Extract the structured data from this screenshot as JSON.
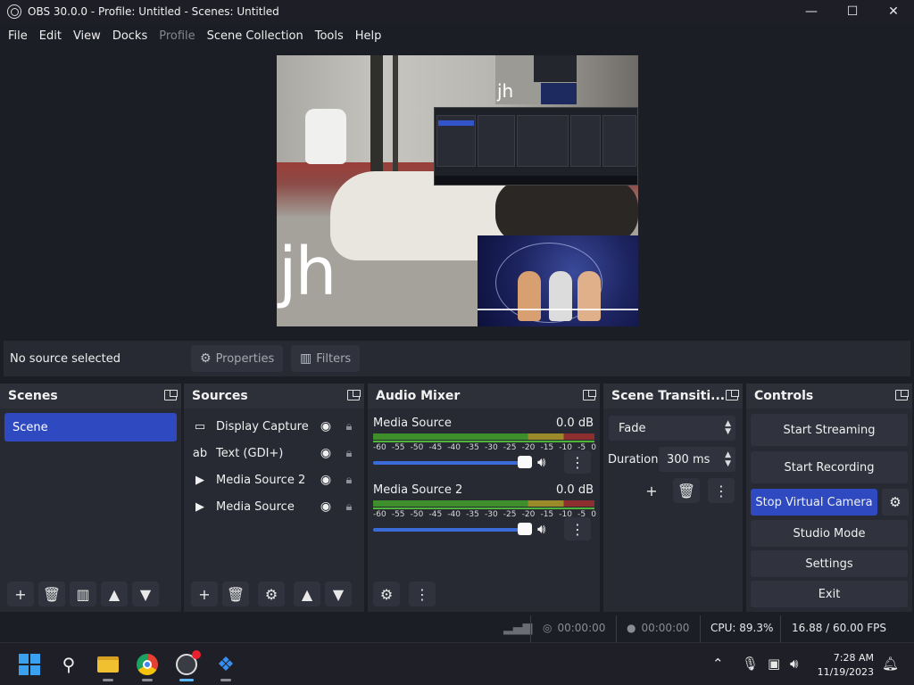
{
  "window": {
    "title": "OBS 30.0.0 - Profile: Untitled - Scenes: Untitled",
    "minimize": "—",
    "maximize": "☐",
    "close": "✕"
  },
  "menu": [
    "File",
    "Edit",
    "View",
    "Docks",
    "Profile",
    "Scene Collection",
    "Tools",
    "Help"
  ],
  "preview": {
    "overlay_text_large": "jh",
    "overlay_text_small": "jh"
  },
  "source_bar": {
    "status": "No source selected",
    "properties_label": "Properties",
    "filters_label": "Filters"
  },
  "scenes": {
    "title": "Scenes",
    "items": [
      "Scene"
    ],
    "selected": "Scene"
  },
  "sources": {
    "title": "Sources",
    "items": [
      {
        "name": "Display Capture",
        "icon": "monitor-icon"
      },
      {
        "name": "Text (GDI+)",
        "icon": "text-icon"
      },
      {
        "name": "Media Source 2",
        "icon": "play-icon"
      },
      {
        "name": "Media Source",
        "icon": "play-icon"
      }
    ]
  },
  "audio_mixer": {
    "title": "Audio Mixer",
    "channels": [
      {
        "name": "Media Source",
        "level": "0.0 dB",
        "volume": 1.0
      },
      {
        "name": "Media Source 2",
        "level": "0.0 dB",
        "volume": 1.0
      }
    ],
    "scale": [
      "-60",
      "-55",
      "-50",
      "-45",
      "-40",
      "-35",
      "-30",
      "-25",
      "-20",
      "-15",
      "-10",
      "-5",
      "0"
    ]
  },
  "transitions": {
    "title": "Scene Transiti...",
    "selected": "Fade",
    "duration_label": "Duration",
    "duration_value": "300 ms"
  },
  "controls": {
    "title": "Controls",
    "start_streaming": "Start Streaming",
    "start_recording": "Start Recording",
    "stop_virtual_camera": "Stop Virtual Camera",
    "studio_mode": "Studio Mode",
    "settings": "Settings",
    "exit": "Exit"
  },
  "status": {
    "stream_time": "00:00:00",
    "record_time": "00:00:00",
    "cpu": "CPU: 89.3%",
    "fps": "16.88 / 60.00 FPS"
  },
  "taskbar": {
    "time": "7:28 AM",
    "date": "11/19/2023"
  },
  "colors": {
    "accent": "#2f4ac0",
    "dock_bg": "#272a33",
    "app_bg": "#1c1e25",
    "slider": "#3a6bd8"
  }
}
